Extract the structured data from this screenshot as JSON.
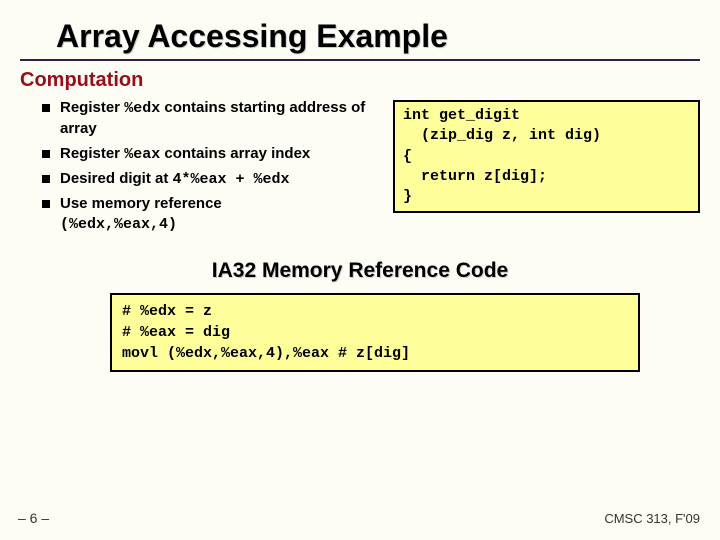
{
  "title": "Array Accessing Example",
  "section": "Computation",
  "bullets": {
    "b1_pre": "Register ",
    "b1_code": "%edx",
    "b1_post": " contains starting address of array",
    "b2_pre": "Register ",
    "b2_code": "%eax",
    "b2_post": " contains array index",
    "b3_pre": "Desired digit at ",
    "b3_code": "4*%eax + %edx",
    "b4": "Use memory reference",
    "b4_sub": "(%edx,%eax,4)"
  },
  "code_c": "int get_digit\n  (zip_dig z, int dig)\n{\n  return z[dig];\n}",
  "ia32_heading": "IA32 Memory Reference Code",
  "code_asm": "# %edx = z\n# %eax = dig\nmovl (%edx,%eax,4),%eax # z[dig]",
  "footer_left": "– 6 –",
  "footer_right": "CMSC 313, F'09"
}
